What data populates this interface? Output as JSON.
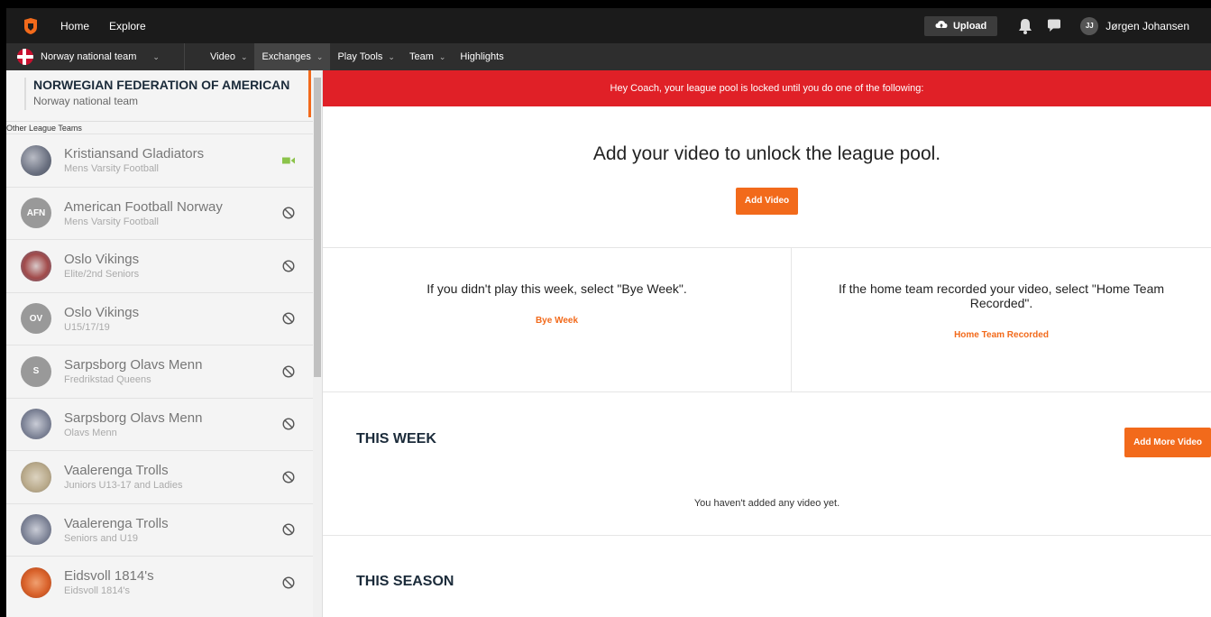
{
  "topbar": {
    "nav": [
      "Home",
      "Explore"
    ],
    "upload_label": "Upload",
    "user_initials": "JJ",
    "user_name": "Jørgen Johansen"
  },
  "subnav": {
    "team": "Norway national team",
    "items": [
      "Video",
      "Exchanges",
      "Play Tools",
      "Team",
      "Highlights"
    ]
  },
  "sidebar": {
    "federation_title": "NORWEGIAN FEDERATION OF AMERICAN",
    "federation_sub": "Norway national team",
    "other_header": "Other League Teams",
    "teams": [
      {
        "name": "Kristiansand Gladiators",
        "sub": "Mens Varsity Football",
        "avatar": "",
        "status": "video-icon"
      },
      {
        "name": "American Football Norway",
        "sub": "Mens Varsity Football",
        "avatar": "AFN",
        "status": "blocked-icon"
      },
      {
        "name": "Oslo Vikings",
        "sub": "Elite/2nd Seniors",
        "avatar": "",
        "status": "blocked-icon"
      },
      {
        "name": "Oslo Vikings",
        "sub": "U15/17/19",
        "avatar": "OV",
        "status": "blocked-icon"
      },
      {
        "name": "Sarpsborg Olavs Menn",
        "sub": "Fredrikstad Queens",
        "avatar": "S",
        "status": "blocked-icon"
      },
      {
        "name": "Sarpsborg Olavs Menn",
        "sub": "Olavs Menn",
        "avatar": "",
        "status": "blocked-icon"
      },
      {
        "name": "Vaalerenga Trolls",
        "sub": "Juniors U13-17 and Ladies",
        "avatar": "",
        "status": "blocked-icon"
      },
      {
        "name": "Vaalerenga Trolls",
        "sub": "Seniors and U19",
        "avatar": "",
        "status": "blocked-icon"
      },
      {
        "name": "Eidsvoll 1814's",
        "sub": "Eidsvoll 1814's",
        "avatar": "",
        "status": "blocked-icon"
      }
    ]
  },
  "main": {
    "alert": "Hey Coach, your league pool is locked until you do one of the following:",
    "unlock_title": "Add your video to unlock the league pool.",
    "add_video": "Add Video",
    "bye_text": "If you didn't play this week, select \"Bye Week\".",
    "bye_link": "Bye Week",
    "home_text": "If the home team recorded your video, select \"Home Team Recorded\".",
    "home_link": "Home Team Recorded",
    "this_week": "THIS WEEK",
    "add_more": "Add More Video",
    "empty": "You haven't added any video yet.",
    "this_season": "THIS SEASON"
  },
  "colors": {
    "accent": "#f26a1b",
    "alert": "#e02027",
    "topbar": "#1b1b1b",
    "subnav": "#2e2e2e",
    "video_status": "#8bc34a"
  }
}
